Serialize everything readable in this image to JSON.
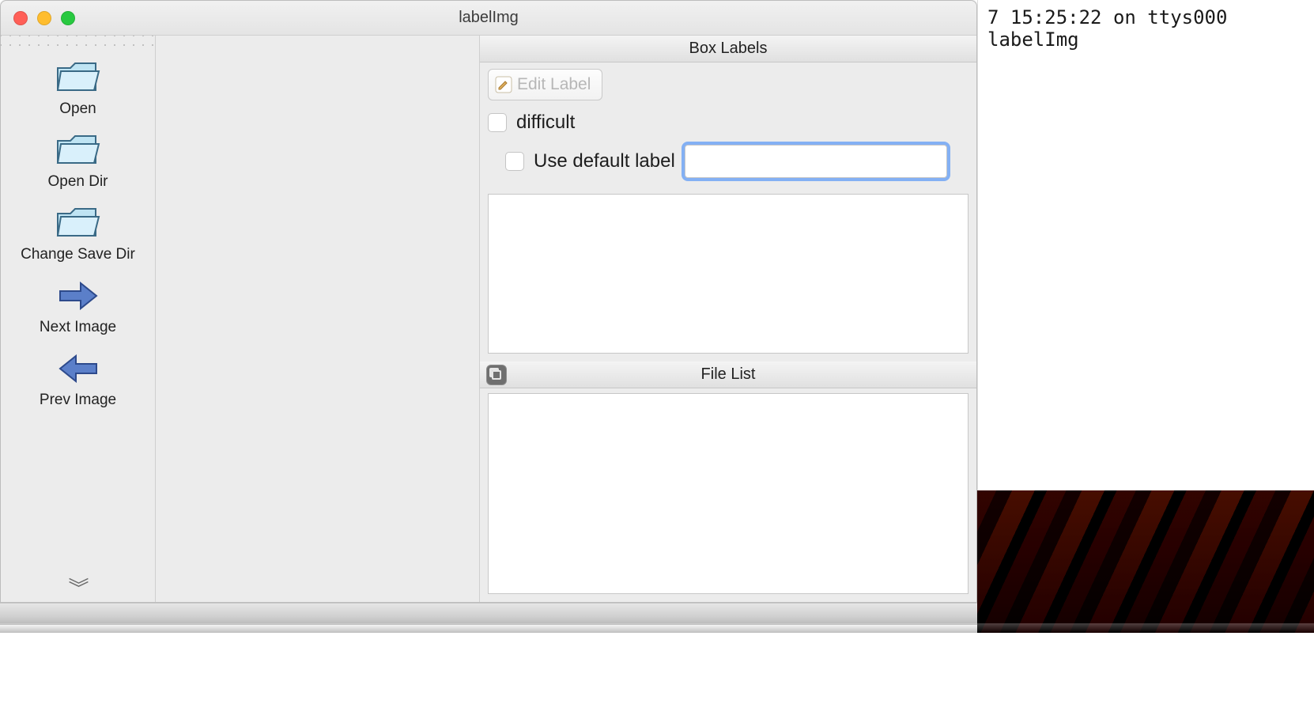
{
  "window": {
    "title": "labelImg"
  },
  "toolbar": {
    "items": [
      {
        "id": "open",
        "label": "Open"
      },
      {
        "id": "open_dir",
        "label": "Open Dir"
      },
      {
        "id": "change_save_dir",
        "label": "Change Save Dir"
      },
      {
        "id": "next_image",
        "label": "Next Image"
      },
      {
        "id": "prev_image",
        "label": "Prev Image"
      }
    ]
  },
  "box_labels": {
    "panel_title": "Box Labels",
    "edit_label_button": "Edit Label",
    "difficult_label": "difficult",
    "difficult_checked": false,
    "use_default_label": "Use default label",
    "use_default_checked": false,
    "default_label_value": ""
  },
  "file_list": {
    "panel_title": "File List"
  },
  "terminal": {
    "line1": "7 15:25:22 on ttys000",
    "line2": "labelImg"
  }
}
